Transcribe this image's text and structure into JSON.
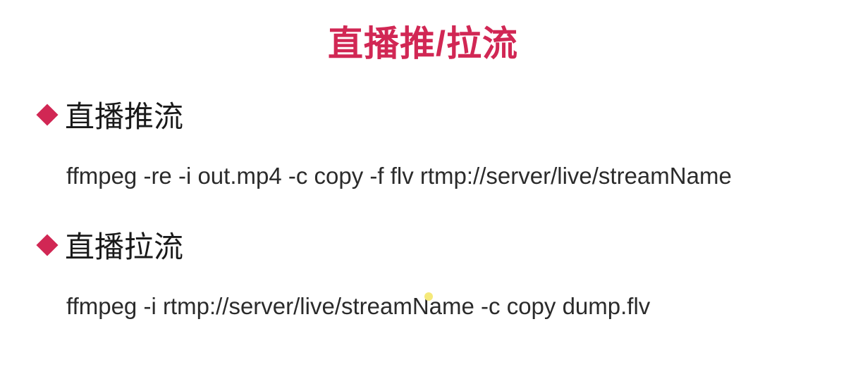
{
  "title": "直播推/拉流",
  "sections": [
    {
      "label": "直播推流",
      "command": "ffmpeg -re -i out.mp4 -c copy -f flv rtmp://server/live/streamName"
    },
    {
      "label": "直播拉流",
      "command": "ffmpeg -i rtmp://server/live/streamName -c copy dump.flv"
    }
  ],
  "colors": {
    "accent": "#d12754",
    "text": "#1a1a1a"
  }
}
